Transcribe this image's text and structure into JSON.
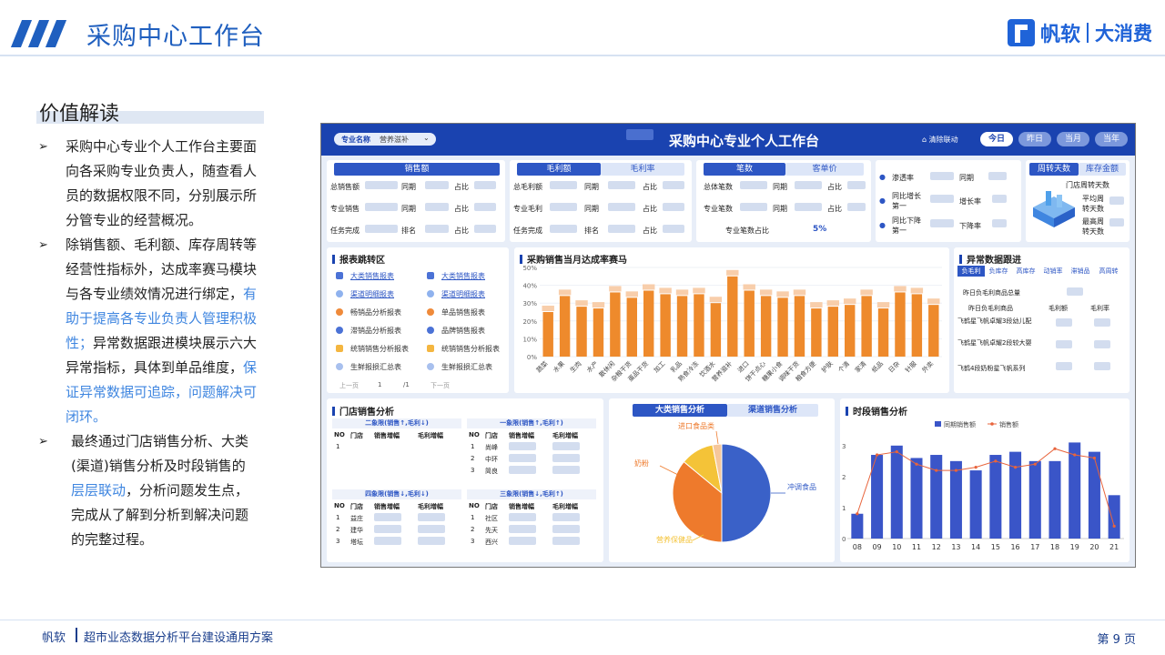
{
  "slide": {
    "title": "采购中心工作台",
    "brand_name": "帆软",
    "brand_sub": "大消费",
    "section_title": "价值解读",
    "footer_brand": "帆软",
    "footer_text": "超市业态数据分析平台建设通用方案",
    "page_label": "第 9 页"
  },
  "bullets": [
    {
      "arrow": "➢",
      "lines": [
        "采购中心专业个人工作台主要面",
        "向各采购专业负责人，随查看人",
        "员的数据权限不同，分别展示所",
        "分管专业的经营概况。"
      ]
    },
    {
      "arrow": "➢",
      "lines": [
        "除销售额、毛利额、库存周转等",
        "经营性指标外，达成率赛马模块",
        "与各专业绩效情况进行绑定，",
        "有",
        "助于提高各专业负责人管理积极",
        "性；",
        "异常数据跟进模块展示六大",
        "异常指标，具体到单品维度，",
        "保",
        "证异常数据可追踪，问题解决可",
        "闭环。"
      ]
    },
    {
      "arrow": "➢",
      "lines": [
        "最终通过门店销售分析、大类",
        "(渠道)销售分析及时段销售的",
        "层层联动",
        "，分析问题发生点，",
        "完成从了解到分析到解决问题",
        "的完整过程。"
      ]
    }
  ],
  "dashboard": {
    "title": "采购中心专业个人工作台",
    "filter_label": "专业名称",
    "filter_value": "营养滋补",
    "clear_label": "清除联动",
    "periods": [
      "今日",
      "昨日",
      "当月",
      "当年"
    ],
    "kpi1": {
      "tabs": [
        "销售额"
      ],
      "rows": [
        [
          "总销售额",
          "同期",
          "占比"
        ],
        [
          "专业销售",
          "同期",
          "占比"
        ],
        [
          "任务完成",
          "排名",
          "占比"
        ]
      ]
    },
    "kpi2": {
      "tabs": [
        "毛利额",
        "毛利率"
      ],
      "rows": [
        [
          "总毛利额",
          "同期",
          "占比"
        ],
        [
          "专业毛利",
          "同期",
          "占比"
        ],
        [
          "任务完成",
          "排名",
          "占比"
        ]
      ]
    },
    "kpi3": {
      "tabs": [
        "笔数",
        "客单价"
      ],
      "rows": [
        [
          "总体笔数",
          "同期",
          "占比"
        ],
        [
          "专业笔数",
          "同期",
          "占比"
        ]
      ],
      "ratio_label": "专业笔数占比",
      "ratio_value": "5%"
    },
    "kpi4": {
      "rows": [
        [
          "渗透率",
          "同期"
        ],
        [
          "同比增长第一",
          "增长率"
        ],
        [
          "同比下降第一",
          "下降率"
        ]
      ]
    },
    "kpi5": {
      "tabs": [
        "周转天数",
        "库存金额"
      ],
      "rows": [
        "门店周转天数",
        "平均周转天数",
        "最高周转天数"
      ]
    },
    "reports": {
      "title": "报表跳转区",
      "left": [
        "大类销售报表",
        "渠道明细报表",
        "畅销品分析报表",
        "滞销品分析报表",
        "统销销售分析报表",
        "生鲜报损汇总表"
      ],
      "right": [
        "大类销售报表",
        "渠道明细报表",
        "单品销售报表",
        "品牌销售报表",
        "统销销售分析报表",
        "生鲜报损汇总表"
      ],
      "pager": [
        "上一页",
        "1",
        "/1",
        "下一页"
      ]
    },
    "race": {
      "title": "采购销售当月达成率赛马"
    },
    "anomaly": {
      "title": "异常数据跟进",
      "tabs": [
        "负毛利",
        "负库存",
        "高库存",
        "动销率",
        "滞销品",
        "高周转"
      ],
      "summary": "昨日负毛利商品总量",
      "headers": [
        "昨日负毛利商品",
        "毛利额",
        "毛利率"
      ],
      "items": [
        "飞鹤星飞帆卓耀3段幼儿配",
        "飞鹤星飞帆卓耀2段较大婴",
        "飞鹤4段奶粉星飞帆系列"
      ]
    },
    "stores": {
      "title": "门店销售分析",
      "quadrants": [
        {
          "name": "二象限(销售↑,毛利↓)",
          "rows": [
            [
              "1",
              ""
            ]
          ]
        },
        {
          "name": "一象限(销售↑,毛利↑)",
          "rows": [
            [
              "1",
              "尚峰"
            ],
            [
              "2",
              "中环"
            ],
            [
              "3",
              "简良"
            ]
          ]
        },
        {
          "name": "四象限(销售↓,毛利↓)",
          "rows": [
            [
              "1",
              "益庄"
            ],
            [
              "2",
              "建华"
            ],
            [
              "3",
              "塔坛"
            ]
          ]
        },
        {
          "name": "三象限(销售↓,毛利↑)",
          "rows": [
            [
              "1",
              "社区"
            ],
            [
              "2",
              "先天"
            ],
            [
              "3",
              "西兴"
            ]
          ]
        }
      ],
      "cols": [
        "NO",
        "门店",
        "销售增幅",
        "毛利增幅"
      ]
    },
    "category": {
      "tabs": [
        "大类销售分析",
        "渠道销售分析"
      ],
      "labels": [
        "进口食品类",
        "奶粉",
        "冲调食品",
        "营养保健品"
      ]
    },
    "hourly": {
      "title": "时段销售分析",
      "legend": [
        "同期销售额",
        "销售额"
      ]
    }
  },
  "chart_data": [
    {
      "type": "bar",
      "title": "采购销售当月达成率赛马",
      "categories": [
        "蔬菜",
        "水果",
        "生肉",
        "水产",
        "散休闲",
        "杂粮干货",
        "蛋品干货",
        "加工",
        "乳品",
        "熟食冷冻",
        "饮酒水",
        "营养滋补",
        "进口",
        "饼干点心",
        "糖果小食",
        "调味干货",
        "粮食方便",
        "护肤",
        "个清",
        "家清",
        "纸品",
        "日杂",
        "针服",
        "外卖"
      ],
      "values": [
        0.25,
        0.34,
        0.28,
        0.27,
        0.36,
        0.33,
        0.37,
        0.35,
        0.34,
        0.35,
        0.3,
        0.45,
        0.37,
        0.34,
        0.33,
        0.34,
        0.27,
        0.28,
        0.29,
        0.34,
        0.27,
        0.36,
        0.35,
        0.29
      ],
      "ylim": [
        0,
        0.5
      ],
      "yticks": [
        "0%",
        "10%",
        "20%",
        "30%",
        "40%",
        "50%"
      ],
      "colors": {
        "bar": "#ee8a2c"
      }
    },
    {
      "type": "pie",
      "labels": [
        "冲调食品",
        "奶粉",
        "营养保健品",
        "进口食品类"
      ],
      "values": [
        50,
        36,
        11,
        3
      ],
      "colors": [
        "#3a61c8",
        "#ee7a2c",
        "#f4c338",
        "#f6c79a"
      ]
    },
    {
      "type": "bar",
      "title": "时段销售分析",
      "categories": [
        "08",
        "09",
        "10",
        "11",
        "12",
        "13",
        "14",
        "15",
        "16",
        "17",
        "18",
        "19",
        "20",
        "21"
      ],
      "series": [
        {
          "name": "同期销售额",
          "values": [
            0.8,
            2.7,
            3.0,
            2.6,
            2.7,
            2.5,
            2.2,
            2.7,
            2.8,
            2.5,
            2.5,
            3.1,
            2.8,
            1.4
          ]
        },
        {
          "name": "销售额",
          "values": [
            0.8,
            2.7,
            2.8,
            2.4,
            2.2,
            2.2,
            2.3,
            2.5,
            2.3,
            2.4,
            2.9,
            2.7,
            2.6,
            0.4
          ]
        }
      ],
      "yticks": [
        "0",
        "1",
        "2",
        "3"
      ],
      "colors": {
        "bar": "#3a55c8",
        "line": "#e8643c"
      }
    }
  ]
}
